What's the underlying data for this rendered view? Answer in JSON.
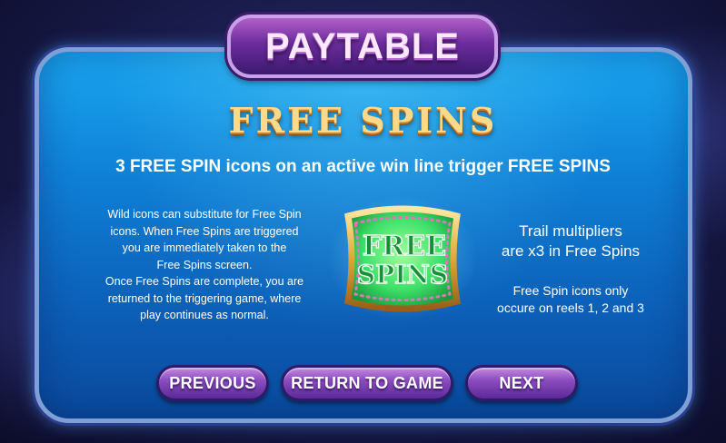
{
  "window": {
    "title": "PAYTABLE"
  },
  "section": {
    "heading": "FREE SPINS"
  },
  "subtitle": "3 FREE SPIN icons on an active win line trigger FREE SPINS",
  "left_text": {
    "lines": [
      "Wild icons can substitute for Free Spin",
      "icons. When Free Spins are triggered",
      "you are immediately taken to the",
      "Free Spins screen.",
      "Once Free Spins are complete, you are",
      "returned to the triggering game, where",
      "play continues as normal."
    ]
  },
  "right_text": {
    "multiplier_lines": [
      "Trail multipliers",
      "are x3 in Free Spins"
    ],
    "reels_lines": [
      "Free Spin icons only",
      "occure on reels 1, 2 and 3"
    ]
  },
  "symbol": {
    "line1": "FREE",
    "line2": "SPINS",
    "icon": "free-spins-symbol-icon"
  },
  "buttons": {
    "previous": "PREVIOUS",
    "return_to_game": "RETURN TO GAME",
    "next": "NEXT"
  },
  "colors": {
    "panel": "#1aa6f0",
    "title_tab": "#6b2c9c",
    "heading_gold": "#ffd98a",
    "button": "#8c4dc0",
    "symbol_green": "#3ee06a"
  }
}
